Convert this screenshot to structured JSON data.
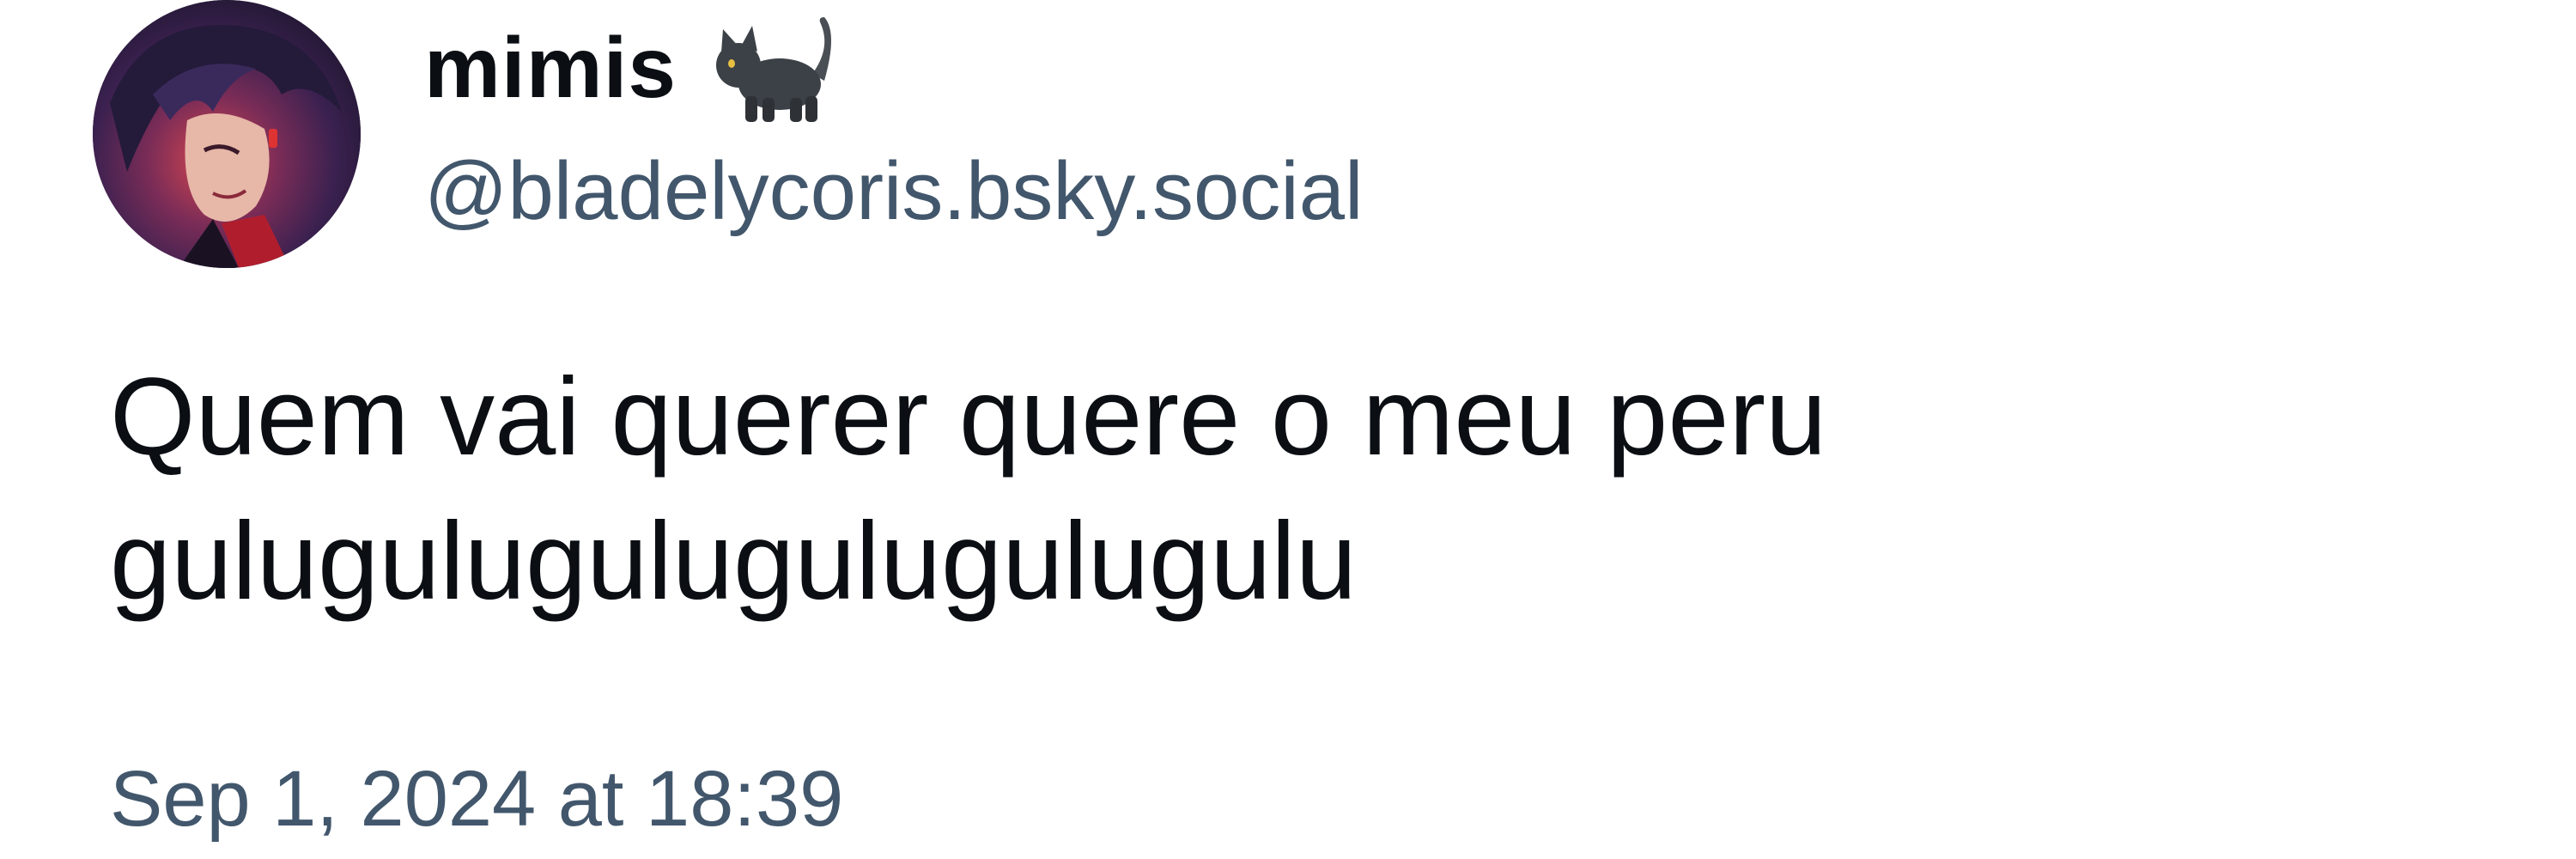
{
  "post": {
    "author": {
      "display_name": "mimis",
      "display_name_emoji": "black-cat-icon",
      "handle": "@bladelycoris.bsky.social",
      "avatar": "user-avatar-image"
    },
    "text": "Quem vai querer quere o meu peru\ngulugulugulugulugulugulu",
    "timestamp": "Sep 1, 2024 at 18:39"
  },
  "colors": {
    "text_primary": "#0b0f14",
    "text_secondary": "#42576c",
    "background": "#ffffff"
  }
}
